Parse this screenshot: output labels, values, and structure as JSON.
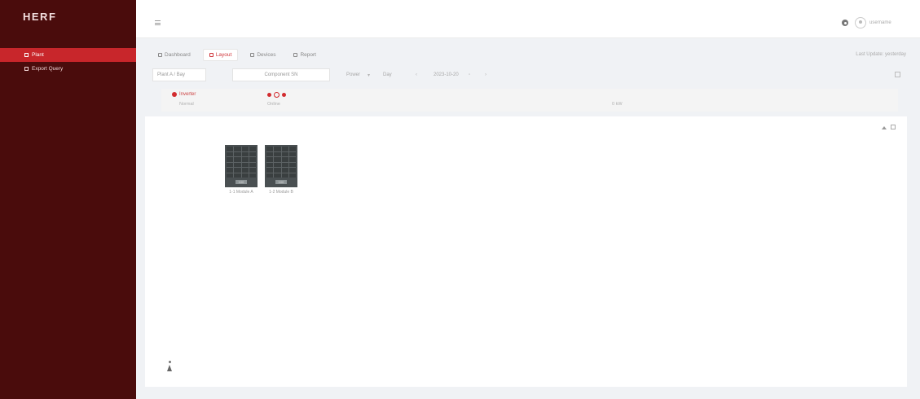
{
  "sidebar": {
    "logo": "HERF",
    "items": [
      {
        "label": "Plant"
      },
      {
        "label": "Export Query"
      }
    ]
  },
  "topbar": {
    "username": "username"
  },
  "tabs": [
    {
      "label": "Dashboard"
    },
    {
      "label": "Layout"
    },
    {
      "label": "Devices"
    },
    {
      "label": "Report"
    }
  ],
  "tabs_right": "Last Update: yesterday",
  "toolbar": {
    "plant": "Plant A / Bay",
    "module_filter": "Component SN",
    "filter_a": "Power",
    "filter_b": "Day",
    "date": "2023-10-20"
  },
  "device": {
    "name": "Inverter",
    "status": "Normal",
    "mid_label": "Online",
    "right_value": "0 kW"
  },
  "modules": [
    {
      "tag": "100",
      "label": "1-1 Module A"
    },
    {
      "tag": "100",
      "label": "1-2 Module B"
    }
  ],
  "colors": {
    "sidebar_bg": "#4a0c0c",
    "accent": "#c8262b",
    "module": "#4a5052"
  }
}
